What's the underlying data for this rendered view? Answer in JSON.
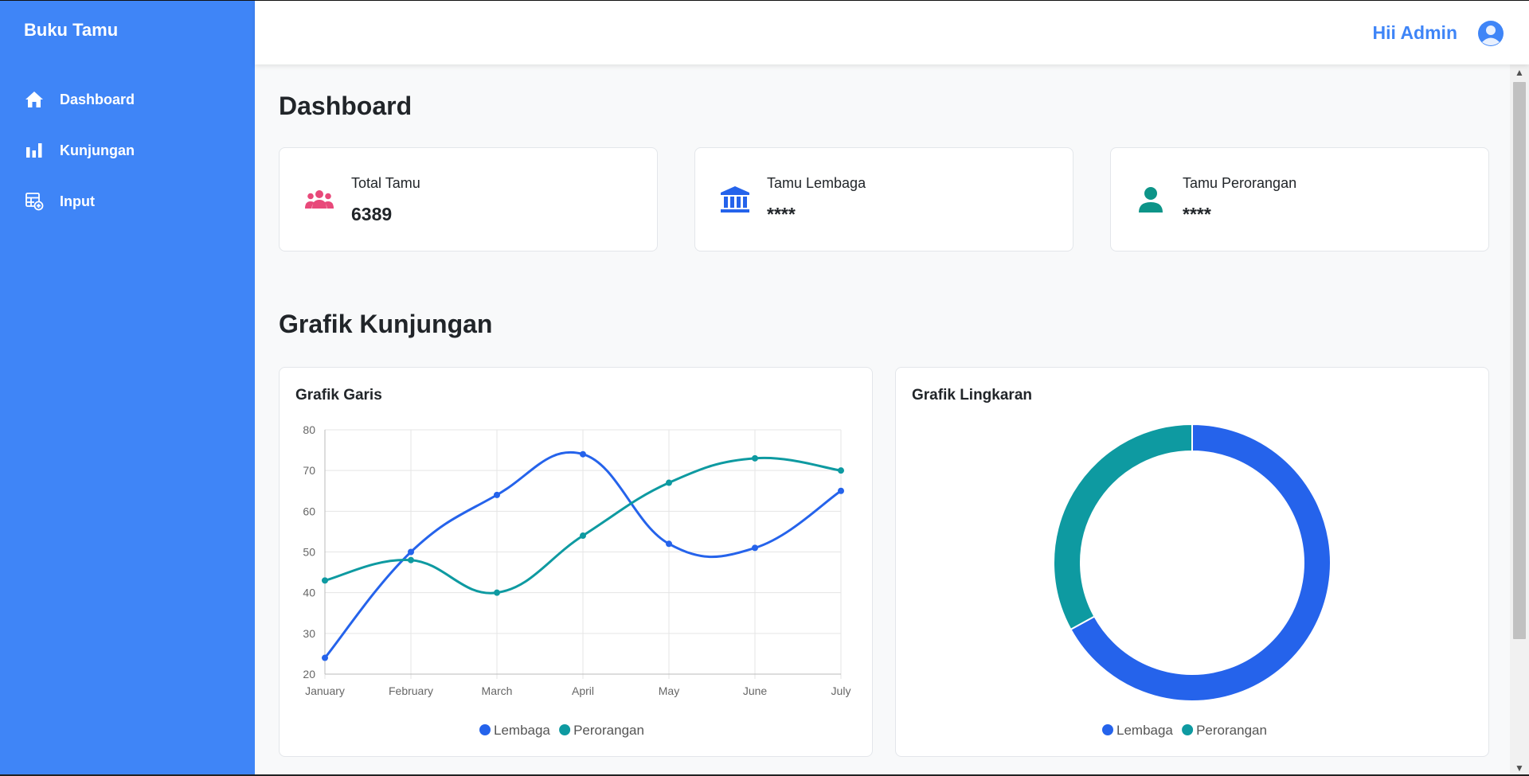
{
  "sidebar": {
    "brand": "Buku Tamu",
    "items": [
      {
        "label": "Dashboard",
        "icon": "home-icon"
      },
      {
        "label": "Kunjungan",
        "icon": "bar-chart-icon"
      },
      {
        "label": "Input",
        "icon": "table-add-icon"
      }
    ]
  },
  "header": {
    "greeting": "Hii Admin",
    "avatar_icon": "user-circle-icon"
  },
  "main": {
    "title": "Dashboard",
    "stats": [
      {
        "label": "Total Tamu",
        "value": "6389",
        "icon": "users-icon",
        "icon_color": "#e8497a"
      },
      {
        "label": "Tamu Lembaga",
        "value": "****",
        "icon": "institution-icon",
        "icon_color": "#2563eb"
      },
      {
        "label": "Tamu Perorangan",
        "value": "****",
        "icon": "person-icon",
        "icon_color": "#0d9488"
      }
    ],
    "section_title": "Grafik Kunjungan",
    "line_chart_title": "Grafik Garis",
    "pie_chart_title": "Grafik Lingkaran"
  },
  "colors": {
    "sidebar_bg": "#3f85f7",
    "accent": "#3f85f7",
    "series_lembaga": "#2563eb",
    "series_perorangan": "#0e9aa1"
  },
  "chart_data": [
    {
      "type": "line",
      "title": "Grafik Garis",
      "categories": [
        "January",
        "February",
        "March",
        "April",
        "May",
        "June",
        "July"
      ],
      "series": [
        {
          "name": "Lembaga",
          "values": [
            24,
            50,
            64,
            74,
            52,
            51,
            65
          ],
          "color": "#2563eb"
        },
        {
          "name": "Perorangan",
          "values": [
            43,
            48,
            40,
            54,
            67,
            73,
            70
          ],
          "color": "#0e9aa1"
        }
      ],
      "ylim": [
        20,
        80
      ],
      "yticks": [
        20,
        30,
        40,
        50,
        60,
        70,
        80
      ],
      "grid": true,
      "legend": "bottom"
    },
    {
      "type": "pie",
      "title": "Grafik Lingkaran",
      "donut": true,
      "labels": [
        "Lembaga",
        "Perorangan"
      ],
      "values": [
        67,
        33
      ],
      "colors": [
        "#2563eb",
        "#0e9aa1"
      ],
      "legend": "bottom"
    }
  ]
}
